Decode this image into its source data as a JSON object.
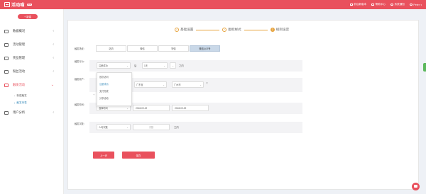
{
  "topbar": {
    "brand": "活动喵",
    "brand_tag": "Beta",
    "links": [
      {
        "label": "前往新版本",
        "icon": "swap-icon"
      },
      {
        "label": "帮助中心",
        "icon": "help-icon"
      },
      {
        "label": "系统通知",
        "icon": "bell-icon"
      },
      {
        "label": "Peter",
        "icon": "user-icon"
      }
    ]
  },
  "sidebar": {
    "new_button": "+ 新建",
    "items": [
      {
        "label": "数据概况",
        "icon": "chart-icon"
      },
      {
        "label": "活动管理",
        "icon": "list-icon"
      },
      {
        "label": "奖品管理",
        "icon": "gift-icon"
      },
      {
        "label": "粉丝活动",
        "icon": "image-icon"
      },
      {
        "label": "触发活动",
        "icon": "trigger-icon"
      },
      {
        "label": "用户分析",
        "icon": "user-icon"
      }
    ],
    "sub_items": [
      {
        "label": "新建触发"
      },
      {
        "label": "触发列表"
      }
    ]
  },
  "steps": [
    {
      "label": "基础设置",
      "badge": "✓"
    },
    {
      "label": "图标样式",
      "badge": "✓"
    },
    {
      "label": "规则设定",
      "badge": "3"
    }
  ],
  "form": {
    "trigger_label": "触发场景：",
    "tabs": [
      "站内",
      "微信",
      "短信",
      "微信公众号"
    ],
    "behavior_label": "触发行为：",
    "behavior_select": "注册成功",
    "behavior_join": "后",
    "behavior_time": "1天",
    "behavior_suffix": "之内",
    "dropdown_options": [
      "首次访问",
      "注册成功",
      "支付完成",
      "分享活动"
    ],
    "users_label": "触发用户：",
    "province": "广东省",
    "city": "广州市",
    "time_label": "触发时间：",
    "time_type": "选择时间",
    "date_start": "2018-09-22",
    "date_end": "2018-09-29",
    "count_label": "触发次数：",
    "count_type": "人均次数",
    "count_placeholder": "次数",
    "count_suffix": "之内"
  },
  "buttons": {
    "prev": "上一步",
    "save": "保存"
  },
  "colors": {
    "accent": "#e9515d",
    "step": "#e6a23c",
    "link": "#3c8dbc"
  }
}
